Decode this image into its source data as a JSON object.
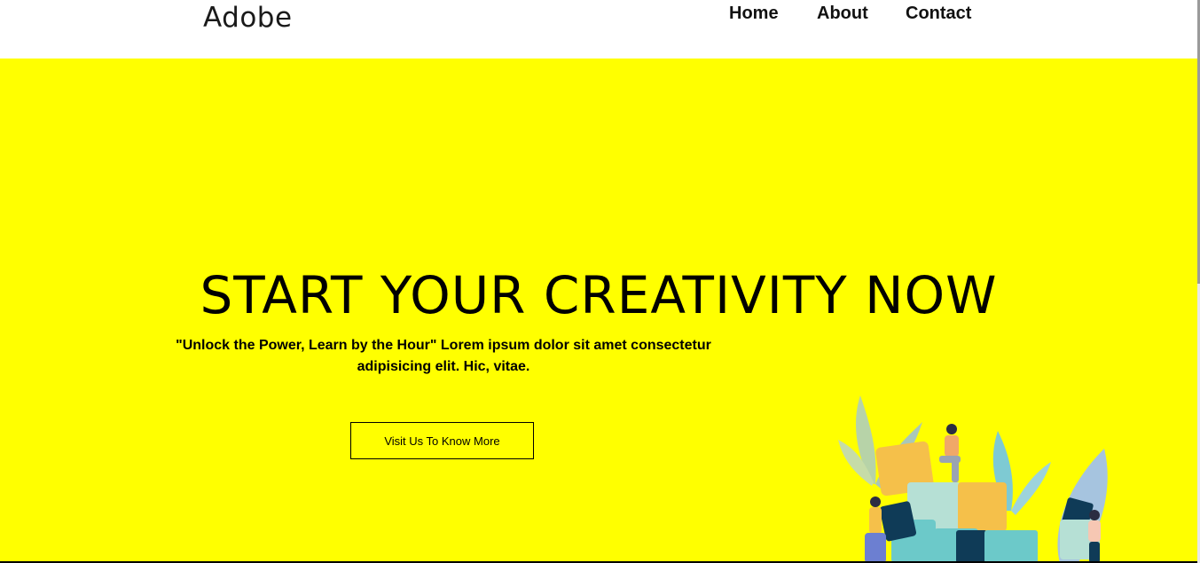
{
  "header": {
    "brand": "Adobe",
    "nav": [
      {
        "label": "Home"
      },
      {
        "label": "About"
      },
      {
        "label": "Contact"
      }
    ]
  },
  "hero": {
    "title": "START YOUR CREATIVITY NOW",
    "subtitle": "\"Unlock the Power, Learn by the Hour\" Lorem ipsum dolor sit amet consectetur adipisicing elit. Hic, vitae.",
    "cta_label": "Visit Us To Know More",
    "illustration_icon": "puzzle-team-illustration"
  },
  "colors": {
    "hero_background": "#ffff00",
    "navbar_background": "#ffffff",
    "text": "#000000"
  }
}
